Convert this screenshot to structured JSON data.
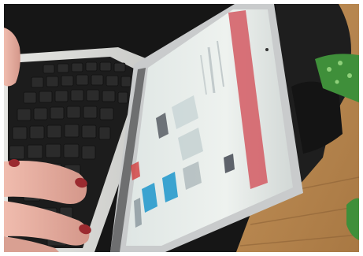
{
  "photo": {
    "subject": "laptop-being-typed-on",
    "colors": {
      "border": "#ffffff",
      "background_dark": "#161616",
      "jacket": "#1e1e1e",
      "wood_floor": "#b9874e",
      "keyboard_deck": "#d9d9d6",
      "key": "#262626",
      "lid_silver": "#c9cbcc",
      "screen_bg": "#e6ece9",
      "screen_header": "#d45a63",
      "screen_accent": "#3ba3d0",
      "skin": "#e3a999",
      "nail_polish": "#9b2a2f",
      "green_fabric": "#3f8f3a"
    }
  }
}
